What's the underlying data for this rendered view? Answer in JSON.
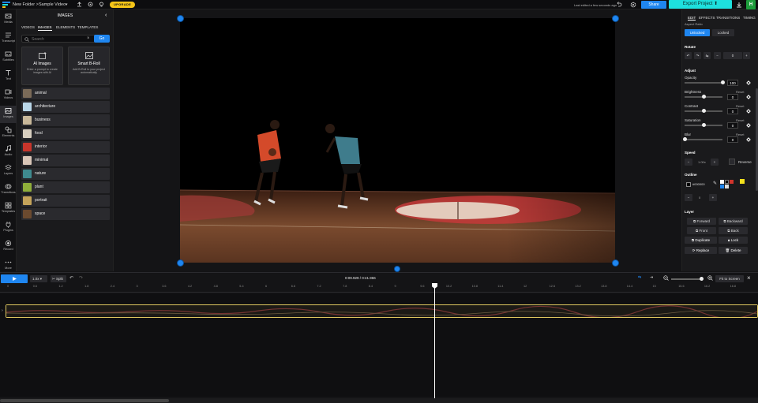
{
  "topbar": {
    "folder": "New Folder",
    "project": "Sample Video",
    "upgrade": "UPGRADE",
    "last_edited": "Last edited a few seconds ago",
    "share": "Share",
    "export": "Export Project",
    "avatar": "H"
  },
  "rail": [
    {
      "label": "Media"
    },
    {
      "label": "Transcript"
    },
    {
      "label": "Subtitles"
    },
    {
      "label": "Text"
    },
    {
      "label": "Videos"
    },
    {
      "label": "Images"
    },
    {
      "label": "Elements"
    },
    {
      "label": "Audio"
    },
    {
      "label": "Layers"
    },
    {
      "label": "Transitions"
    },
    {
      "label": "Templates"
    },
    {
      "label": "Plugins"
    },
    {
      "label": "Record"
    },
    {
      "label": "More"
    }
  ],
  "panel": {
    "title": "IMAGES",
    "tabs": [
      "VIDEOS",
      "IMAGES",
      "ELEMENTS",
      "TEMPLATES"
    ],
    "search_placeholder": "Search",
    "go": "Go",
    "card_ai": {
      "title": "AI Images",
      "desc": "Enter a prompt to create images with AI"
    },
    "card_broll": {
      "title": "Smart B-Roll",
      "desc": "Add B-Roll to your project automatically"
    },
    "categories": [
      {
        "label": "animal",
        "color": "#7a6a58"
      },
      {
        "label": "architecture",
        "color": "#b9d6e8"
      },
      {
        "label": "business",
        "color": "#c9b89a"
      },
      {
        "label": "food",
        "color": "#d8cfc0"
      },
      {
        "label": "interior",
        "color": "#c8352b"
      },
      {
        "label": "minimal",
        "color": "#d9c6b8"
      },
      {
        "label": "nature",
        "color": "#3f8a8f"
      },
      {
        "label": "plant",
        "color": "#8fae3a"
      },
      {
        "label": "portrait",
        "color": "#c4a35a"
      },
      {
        "label": "space",
        "color": "#6b4a2f"
      }
    ]
  },
  "right": {
    "tabs": [
      "EDIT",
      "EFFECTS",
      "TRANSITIONS",
      "TIMING"
    ],
    "aspect_label": "Aspect Ratio",
    "unlocked": "Unlocked",
    "locked": "Locked",
    "rotate": "Rotate",
    "rotate_value": "0",
    "adjust": "Adjust",
    "reset": "Reset",
    "opacity": {
      "label": "Opacity",
      "value": "100",
      "level": 1.0
    },
    "brightness": {
      "label": "Brightness",
      "value": "0",
      "level": 0.5
    },
    "contrast": {
      "label": "Contrast",
      "value": "0",
      "level": 0.5
    },
    "saturation": {
      "label": "Saturation",
      "value": "0",
      "level": 0.5
    },
    "blur": {
      "label": "Blur",
      "value": "0",
      "level": 0.0
    },
    "speed": "Speed",
    "speed_value": "1.00x",
    "reverse": "Reverse",
    "outline": "Outline",
    "outline_color": "#000000",
    "outline_width": "0",
    "layer": "Layer",
    "forward": "Forward",
    "backward": "Backward",
    "front": "Front",
    "back": "Back",
    "duplicate": "Duplicate",
    "lock": "Lock",
    "replace": "Replace",
    "delete": "Delete"
  },
  "timeline": {
    "speed": "1.0x",
    "split": "Split",
    "time": "0:09.929 / 0:41.966",
    "fit": "Fit to Screen",
    "ticks": [
      "0",
      "0.6",
      "1.2",
      "1.8",
      "2.4",
      "3",
      "3.6",
      "4.2",
      "4.8",
      "5.4",
      "6",
      "6.6",
      "7.2",
      "7.8",
      "8.4",
      "9",
      "9.6",
      "10.2",
      "10.8",
      "11.4",
      "12",
      "12.6",
      "13.2",
      "13.8",
      "14.4",
      "15",
      "15.6",
      "16.2",
      "16.8"
    ]
  },
  "colors": {
    "accent": "#1f86f0",
    "export": "#1ee0dd",
    "upgrade": "#f5c518",
    "track_border": "#e0c860"
  }
}
